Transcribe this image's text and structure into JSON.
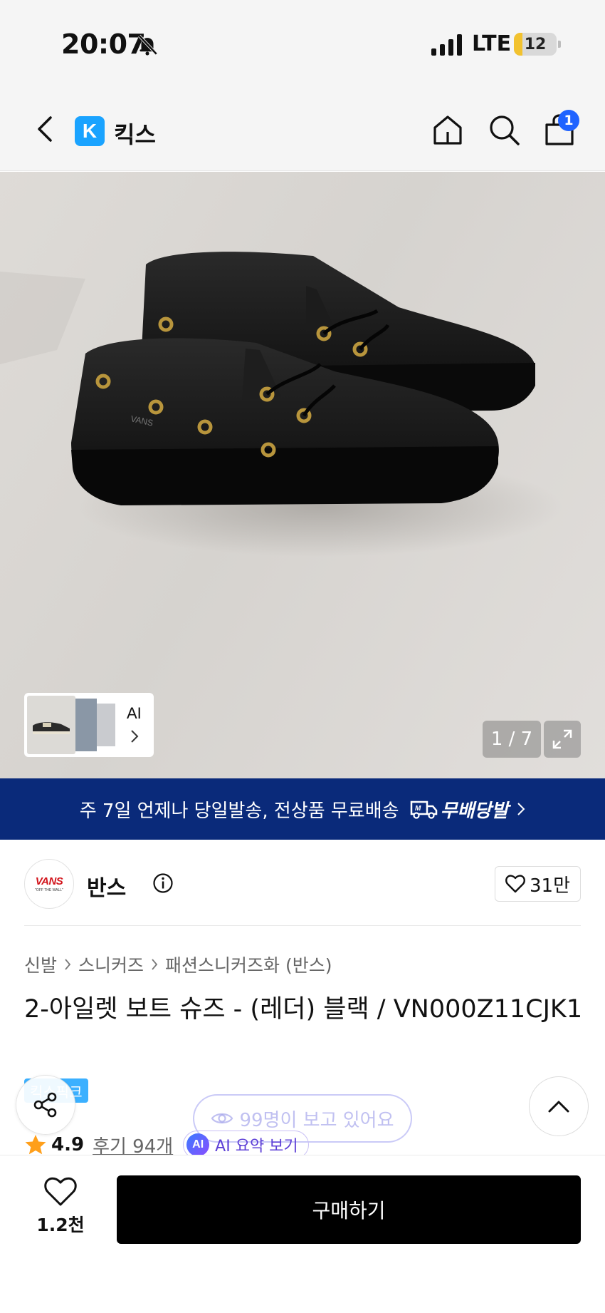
{
  "status_bar": {
    "time": "20:07",
    "network": "LTE",
    "battery": "12",
    "battery_level": 0.12
  },
  "nav": {
    "brand_logo_letter": "K",
    "brand_name": "킥스",
    "cart_count": "1"
  },
  "gallery": {
    "thumb_label": "AI",
    "counter": "1 / 7"
  },
  "shipping_banner": {
    "text": "주 7일 언제나 당일발송, 전상품 무료배송",
    "badge": "무배당발"
  },
  "brand": {
    "logo_text": "VANS",
    "logo_subtext": "\"OFF THE WALL\"",
    "name": "반스",
    "likes": "31만"
  },
  "breadcrumb": [
    "신발",
    "스니커즈",
    "패션스니커즈화 (반스)"
  ],
  "product": {
    "title": "2-아일렛 보트 슈즈 - (레더) 블랙 / VN000Z11CJK1",
    "tag": "킥스픽크",
    "viewers": "99명이 보고 있어요",
    "rating": "4.9",
    "reviews": "후기 94개",
    "ai_badge": "AI",
    "ai_summary": "AI 요약 보기"
  },
  "bottom_bar": {
    "wish_count": "1.2천",
    "buy_label": "구매하기"
  },
  "colors": {
    "accent_blue": "#1aa3ff",
    "banner_navy": "#0a2a7a",
    "cart_badge": "#1f63ff",
    "star": "#ff9f1a",
    "ai_purple": "#5d3fd6"
  }
}
